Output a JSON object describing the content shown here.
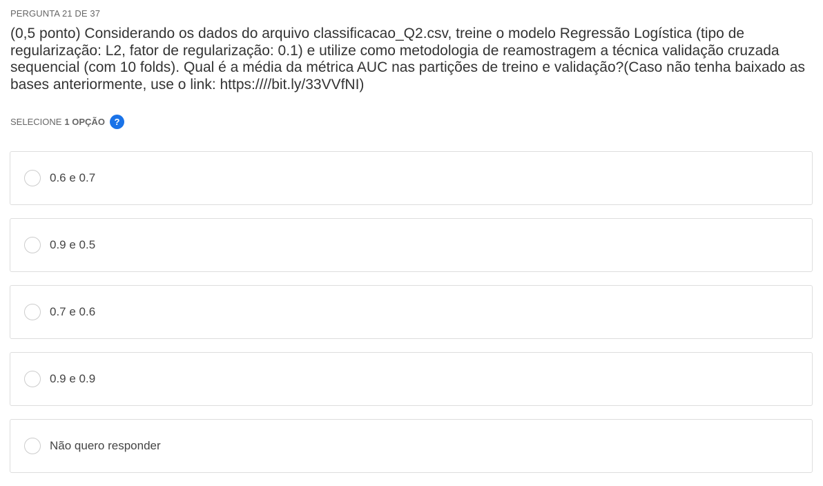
{
  "header": {
    "question_counter": "PERGUNTA 21 DE 37"
  },
  "question": {
    "text": "(0,5 ponto) Considerando os dados do arquivo classificacao_Q2.csv, treine o modelo Regressão Logística (tipo de regularização: L2, fator de regularização: 0.1) e utilize como metodologia de reamostragem a técnica validação cruzada sequencial (com 10 folds). Qual é a média da métrica AUC nas partições de treino e validação?(Caso não tenha baixado as bases anteriormente, use o link: https:////bit.ly/33VVfNI)"
  },
  "instruction": {
    "prefix": "SELECIONE",
    "count": "1 OPÇÃO",
    "help_icon_glyph": "?",
    "help_icon_color": "#1a73e8"
  },
  "options": [
    {
      "label": "0.6 e 0.7",
      "selected": false
    },
    {
      "label": "0.9 e 0.5",
      "selected": false
    },
    {
      "label": "0.7 e 0.6",
      "selected": false
    },
    {
      "label": "0.9 e 0.9",
      "selected": false
    },
    {
      "label": "Não quero responder",
      "selected": false
    }
  ]
}
